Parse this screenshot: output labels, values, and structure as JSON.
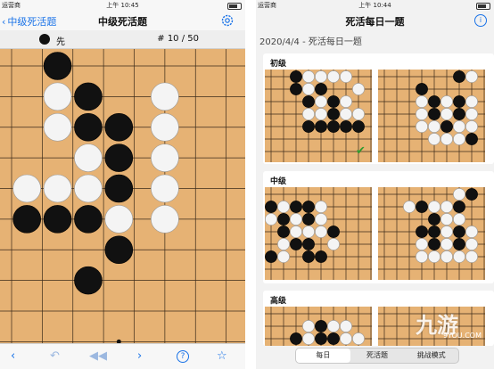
{
  "left_screen": {
    "status": {
      "carrier": "运营商",
      "time": "上午 10:45"
    },
    "nav": {
      "back_label": "中级死活题",
      "title": "中级死活题"
    },
    "info": {
      "to_play": "先",
      "counter": "# 10 / 50"
    },
    "board": {
      "grid_size": 10,
      "star_points": [
        [
          3.5,
          9
        ]
      ],
      "stones": [
        {
          "c": "b",
          "x": 1.5,
          "y": 0
        },
        {
          "c": "w",
          "x": 1.5,
          "y": 1
        },
        {
          "c": "b",
          "x": 2.5,
          "y": 1
        },
        {
          "c": "w",
          "x": 5,
          "y": 1
        },
        {
          "c": "w",
          "x": 1.5,
          "y": 2
        },
        {
          "c": "b",
          "x": 2.5,
          "y": 2
        },
        {
          "c": "b",
          "x": 3.5,
          "y": 2
        },
        {
          "c": "w",
          "x": 5,
          "y": 2
        },
        {
          "c": "w",
          "x": 2.5,
          "y": 3
        },
        {
          "c": "b",
          "x": 3.5,
          "y": 3
        },
        {
          "c": "w",
          "x": 5,
          "y": 3
        },
        {
          "c": "w",
          "x": 0.5,
          "y": 4
        },
        {
          "c": "w",
          "x": 1.5,
          "y": 4
        },
        {
          "c": "w",
          "x": 2.5,
          "y": 4
        },
        {
          "c": "b",
          "x": 3.5,
          "y": 4
        },
        {
          "c": "w",
          "x": 5,
          "y": 4
        },
        {
          "c": "b",
          "x": 0.5,
          "y": 5
        },
        {
          "c": "b",
          "x": 1.5,
          "y": 5
        },
        {
          "c": "b",
          "x": 2.5,
          "y": 5
        },
        {
          "c": "w",
          "x": 3.5,
          "y": 5
        },
        {
          "c": "w",
          "x": 5,
          "y": 5
        },
        {
          "c": "b",
          "x": 3.5,
          "y": 6
        },
        {
          "c": "b",
          "x": 2.5,
          "y": 7
        }
      ]
    }
  },
  "right_screen": {
    "status": {
      "carrier": "运营商",
      "time": "上午 10:44"
    },
    "nav": {
      "title": "死活每日一题"
    },
    "date_line": "2020/4/4 - 死活每日一题",
    "sections": [
      {
        "label": "初级",
        "solved": true,
        "boards": [
          {
            "stones": [
              {
                "c": "b",
                "x": 2,
                "y": 0
              },
              {
                "c": "w",
                "x": 3,
                "y": 0
              },
              {
                "c": "w",
                "x": 4,
                "y": 0
              },
              {
                "c": "w",
                "x": 5,
                "y": 0
              },
              {
                "c": "w",
                "x": 6,
                "y": 0
              },
              {
                "c": "b",
                "x": 2,
                "y": 1
              },
              {
                "c": "w",
                "x": 3,
                "y": 1
              },
              {
                "c": "b",
                "x": 4,
                "y": 1
              },
              {
                "c": "w",
                "x": 7,
                "y": 1
              },
              {
                "c": "b",
                "x": 3,
                "y": 2
              },
              {
                "c": "w",
                "x": 4,
                "y": 2
              },
              {
                "c": "b",
                "x": 5,
                "y": 2
              },
              {
                "c": "w",
                "x": 6,
                "y": 2
              },
              {
                "c": "w",
                "x": 3,
                "y": 3
              },
              {
                "c": "w",
                "x": 4,
                "y": 3
              },
              {
                "c": "b",
                "x": 5,
                "y": 3
              },
              {
                "c": "w",
                "x": 6,
                "y": 3
              },
              {
                "c": "w",
                "x": 7,
                "y": 3
              },
              {
                "c": "b",
                "x": 3,
                "y": 4
              },
              {
                "c": "b",
                "x": 4,
                "y": 4
              },
              {
                "c": "b",
                "x": 5,
                "y": 4
              },
              {
                "c": "b",
                "x": 6,
                "y": 4
              },
              {
                "c": "b",
                "x": 7,
                "y": 4
              }
            ]
          },
          {
            "stones": [
              {
                "c": "b",
                "x": 3,
                "y": 1
              },
              {
                "c": "b",
                "x": 6,
                "y": 0
              },
              {
                "c": "w",
                "x": 7,
                "y": 0
              },
              {
                "c": "w",
                "x": 3,
                "y": 2
              },
              {
                "c": "b",
                "x": 4,
                "y": 2
              },
              {
                "c": "w",
                "x": 5,
                "y": 2
              },
              {
                "c": "b",
                "x": 6,
                "y": 2
              },
              {
                "c": "w",
                "x": 7,
                "y": 2
              },
              {
                "c": "w",
                "x": 3,
                "y": 3
              },
              {
                "c": "b",
                "x": 4,
                "y": 3
              },
              {
                "c": "w",
                "x": 5,
                "y": 3
              },
              {
                "c": "b",
                "x": 6,
                "y": 3
              },
              {
                "c": "w",
                "x": 7,
                "y": 3
              },
              {
                "c": "w",
                "x": 3,
                "y": 4
              },
              {
                "c": "w",
                "x": 4,
                "y": 4
              },
              {
                "c": "b",
                "x": 5,
                "y": 4
              },
              {
                "c": "w",
                "x": 6,
                "y": 4
              },
              {
                "c": "w",
                "x": 7,
                "y": 4
              },
              {
                "c": "w",
                "x": 4,
                "y": 5
              },
              {
                "c": "w",
                "x": 5,
                "y": 5
              },
              {
                "c": "w",
                "x": 6,
                "y": 5
              },
              {
                "c": "b",
                "x": 7,
                "y": 5
              }
            ]
          }
        ]
      },
      {
        "label": "中级",
        "solved": false,
        "boards": [
          {
            "stones": [
              {
                "c": "b",
                "x": 0,
                "y": 1
              },
              {
                "c": "w",
                "x": 1,
                "y": 1
              },
              {
                "c": "b",
                "x": 2,
                "y": 1
              },
              {
                "c": "b",
                "x": 3,
                "y": 1
              },
              {
                "c": "w",
                "x": 4,
                "y": 1
              },
              {
                "c": "w",
                "x": 0,
                "y": 2
              },
              {
                "c": "b",
                "x": 1,
                "y": 2
              },
              {
                "c": "w",
                "x": 2,
                "y": 2
              },
              {
                "c": "b",
                "x": 3,
                "y": 2
              },
              {
                "c": "w",
                "x": 4,
                "y": 2
              },
              {
                "c": "b",
                "x": 1,
                "y": 3
              },
              {
                "c": "w",
                "x": 2,
                "y": 3
              },
              {
                "c": "w",
                "x": 3,
                "y": 3
              },
              {
                "c": "w",
                "x": 4,
                "y": 3
              },
              {
                "c": "b",
                "x": 5,
                "y": 3
              },
              {
                "c": "w",
                "x": 1,
                "y": 4
              },
              {
                "c": "b",
                "x": 2,
                "y": 4
              },
              {
                "c": "b",
                "x": 3,
                "y": 4
              },
              {
                "c": "w",
                "x": 5,
                "y": 4
              },
              {
                "c": "b",
                "x": 0,
                "y": 5
              },
              {
                "c": "w",
                "x": 1,
                "y": 5
              },
              {
                "c": "b",
                "x": 3,
                "y": 5
              },
              {
                "c": "b",
                "x": 4,
                "y": 5
              }
            ]
          },
          {
            "stones": [
              {
                "c": "w",
                "x": 6,
                "y": 0
              },
              {
                "c": "b",
                "x": 7,
                "y": 0
              },
              {
                "c": "w",
                "x": 2,
                "y": 1
              },
              {
                "c": "b",
                "x": 3,
                "y": 1
              },
              {
                "c": "w",
                "x": 4,
                "y": 1
              },
              {
                "c": "w",
                "x": 5,
                "y": 1
              },
              {
                "c": "b",
                "x": 6,
                "y": 1
              },
              {
                "c": "b",
                "x": 4,
                "y": 2
              },
              {
                "c": "w",
                "x": 5,
                "y": 2
              },
              {
                "c": "w",
                "x": 6,
                "y": 2
              },
              {
                "c": "b",
                "x": 3,
                "y": 3
              },
              {
                "c": "b",
                "x": 4,
                "y": 3
              },
              {
                "c": "w",
                "x": 5,
                "y": 3
              },
              {
                "c": "b",
                "x": 6,
                "y": 3
              },
              {
                "c": "w",
                "x": 7,
                "y": 3
              },
              {
                "c": "w",
                "x": 3,
                "y": 4
              },
              {
                "c": "b",
                "x": 4,
                "y": 4
              },
              {
                "c": "w",
                "x": 5,
                "y": 4
              },
              {
                "c": "b",
                "x": 6,
                "y": 4
              },
              {
                "c": "w",
                "x": 7,
                "y": 4
              },
              {
                "c": "w",
                "x": 3,
                "y": 5
              },
              {
                "c": "w",
                "x": 4,
                "y": 5
              },
              {
                "c": "w",
                "x": 5,
                "y": 5
              },
              {
                "c": "w",
                "x": 6,
                "y": 5
              },
              {
                "c": "w",
                "x": 7,
                "y": 5
              }
            ]
          }
        ]
      },
      {
        "label": "高级",
        "solved": false,
        "boards": [
          {
            "stones": [
              {
                "c": "w",
                "x": 3,
                "y": 1
              },
              {
                "c": "b",
                "x": 4,
                "y": 1
              },
              {
                "c": "w",
                "x": 5,
                "y": 1
              },
              {
                "c": "w",
                "x": 6,
                "y": 1
              },
              {
                "c": "b",
                "x": 2,
                "y": 2
              },
              {
                "c": "w",
                "x": 3,
                "y": 2
              },
              {
                "c": "b",
                "x": 4,
                "y": 2
              },
              {
                "c": "b",
                "x": 5,
                "y": 2
              },
              {
                "c": "w",
                "x": 6,
                "y": 2
              },
              {
                "c": "w",
                "x": 7,
                "y": 2
              }
            ]
          },
          {
            "stones": []
          }
        ]
      }
    ],
    "segments": [
      "每日",
      "死活题",
      "挑战模式"
    ],
    "active_segment": 0
  },
  "watermark": {
    "text": "九游",
    "sub": "9YOU.COM"
  },
  "colors": {
    "accent": "#1a73e8",
    "board": "#e6b274",
    "check": "#2e9b2e"
  }
}
